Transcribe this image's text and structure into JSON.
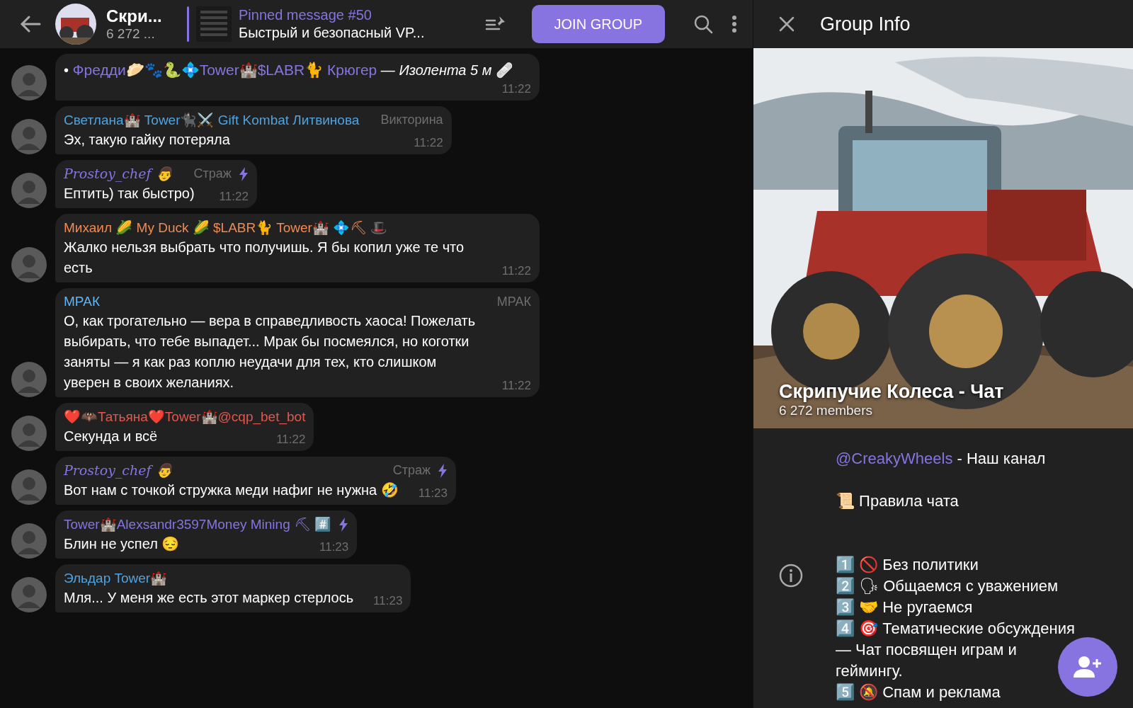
{
  "header": {
    "title": "Скри...",
    "subtitle": "6 272 ...",
    "pinned_title": "Pinned message #50",
    "pinned_text": "Быстрый и безопасный VP...",
    "join_button": "JOIN GROUP"
  },
  "messages": [
    {
      "kind": "list",
      "bullet": "•",
      "link": "Фредди🥟🐾🐍💠Tower🏰$LABR🐈 Крюгер",
      "text": "— *Изолента 5 м* 🩹",
      "time": "11:22"
    },
    {
      "kind": "plain",
      "sender": "Светлана🏰 Tower🐈‍⬛⚔️ Gift Kombat Литвинова",
      "color": "#4fa3e0",
      "script": false,
      "badge": "Викторина",
      "boost": false,
      "text": "Эх, такую гайку потеряла",
      "time": "11:22"
    },
    {
      "kind": "plain",
      "sender": "Prostoy_chef 👨",
      "color": "#8774e1",
      "script": true,
      "badge": "Страж",
      "boost": true,
      "text": "Ептить) так быстро)",
      "time": "11:22"
    },
    {
      "kind": "plain",
      "sender": "Михаил 🌽 My Duck 🌽 $LABR🐈 Tower🏰 💠⛏ 🎩",
      "color": "#f08a52",
      "script": false,
      "boost": false,
      "text": "Жалко нельзя выбрать что получишь. Я бы копил уже те что есть",
      "time": "11:22"
    },
    {
      "kind": "plain",
      "sender": "МРАК",
      "color": "#5eb5f7",
      "script": false,
      "badge": "МРАК",
      "boost": false,
      "text": "О, как трогательно — вера в справедливость хаоса! Пожелать выбирать, что тебе выпадет... Мрак бы посмеялся, но коготки заняты — я как раз коплю неудачи для тех, кто слишком уверен в своих желаниях.",
      "time": "11:22"
    },
    {
      "kind": "plain",
      "sender": "❤️🦇Татьяна❤️Tower🏰@cqp_bet_bot",
      "color": "#e5564d",
      "script": false,
      "boost": false,
      "text": "Секунда и всё",
      "time": "11:22"
    },
    {
      "kind": "plain",
      "sender": "Prostoy_chef 👨",
      "color": "#8774e1",
      "script": true,
      "badge": "Страж",
      "boost": true,
      "text": "Вот нам с точкой стружка меди нафиг не нужна 🤣",
      "time": "11:23"
    },
    {
      "kind": "plain",
      "sender": "Tower🏰Alexsandr3597Money Mining ⛏ #️⃣",
      "color": "#8774e1",
      "script": false,
      "boost": true,
      "text": "Блин не успел 😔",
      "time": "11:23"
    },
    {
      "kind": "plain",
      "sender": "Эльдар Tower🏰",
      "color": "#4fa3e0",
      "script": false,
      "boost": false,
      "text": "Мля... У меня же есть этот маркер стерлось",
      "time": "11:23"
    }
  ],
  "info_panel": {
    "title": "Group Info",
    "group_name": "Скрипучие Колеса - Чат",
    "members": "6 272 members",
    "description": [
      {
        "kind": "link_line",
        "link": "@CreakyWheels",
        "text": "- Наш канал"
      },
      {
        "kind": "gap"
      },
      {
        "kind": "line",
        "text": "📜 Правила чата"
      },
      {
        "kind": "gap"
      },
      {
        "kind": "gap"
      },
      {
        "kind": "line",
        "text": "1️⃣ 🚫 Без политики"
      },
      {
        "kind": "line",
        "text": "2️⃣ 🗣 Общаемся с уважением"
      },
      {
        "kind": "line",
        "text": "3️⃣ 🤝 Не ругаемся"
      },
      {
        "kind": "line",
        "text": "4️⃣ 🎯 Тематические обсуждения — Чат посвящен играм и геймингу."
      },
      {
        "kind": "line",
        "text": "5️⃣ 🔕 Спам и реклама"
      }
    ]
  }
}
